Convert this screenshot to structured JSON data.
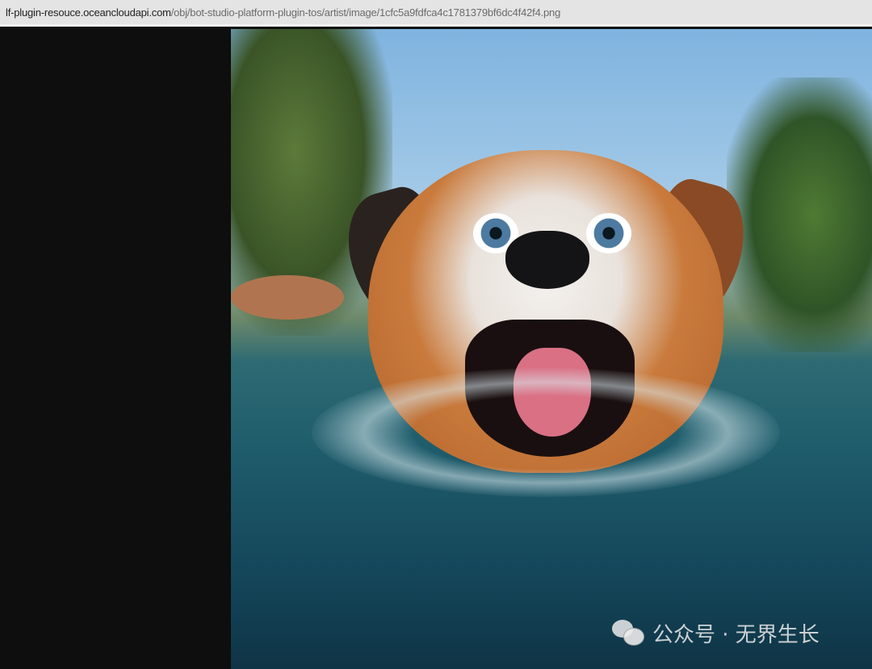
{
  "address_bar": {
    "host": "lf-plugin-resouce.oceancloudapi.com",
    "path": "/obj/bot-studio-platform-plugin-tos/artist/image/1cfc5a9fdfca4c1781379bf6dc4f42f4.png"
  },
  "image": {
    "alt": "Cartoon dog swimming in water"
  },
  "watermark": {
    "icon": "wechat-icon",
    "text": "公众号 · 无界生长"
  }
}
